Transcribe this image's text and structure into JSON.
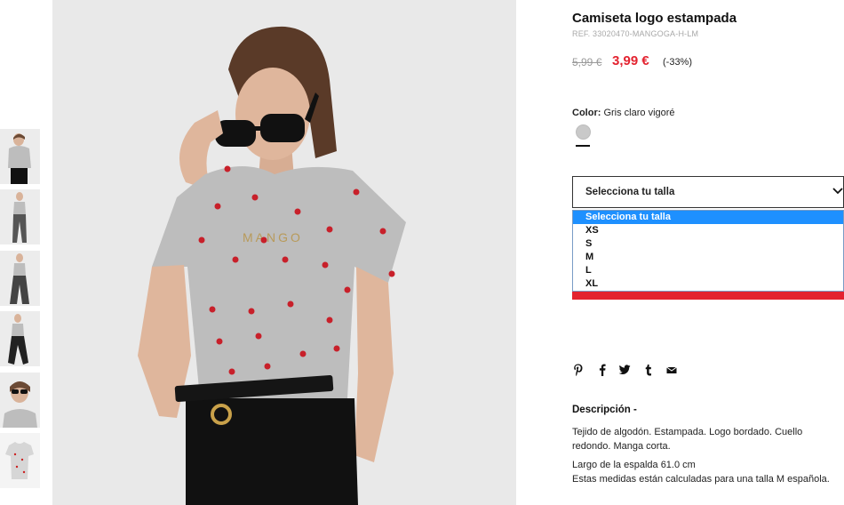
{
  "product": {
    "title": "Camiseta logo estampada",
    "ref": "REF. 33020470-MANGOGA-H-LM",
    "old_price": "5,99 €",
    "new_price": "3,99 €",
    "discount": "(-33%)",
    "print_text": "MANGO"
  },
  "color": {
    "label": "Color:",
    "value": "Gris claro vigoré",
    "swatch_hex": "#c9c9c9"
  },
  "size": {
    "select_label": "Selecciona tu talla",
    "options": [
      "Selecciona tu talla",
      "XS",
      "S",
      "M",
      "L",
      "XL"
    ],
    "selected_index": 0
  },
  "social_icons": [
    "pinterest-icon",
    "facebook-icon",
    "twitter-icon",
    "tumblr-icon",
    "email-icon"
  ],
  "description": {
    "heading": "Descripción -",
    "body": "Tejido de algodón. Estampada. Logo bordado. Cuello redondo. Manga corta.",
    "back_length": "Largo de la espalda 61.0 cm",
    "measure_note": "Estas medidas están calculadas para una talla M española."
  },
  "colors": {
    "accent_red": "#e3222f",
    "selected_option_blue": "#1e90ff"
  }
}
